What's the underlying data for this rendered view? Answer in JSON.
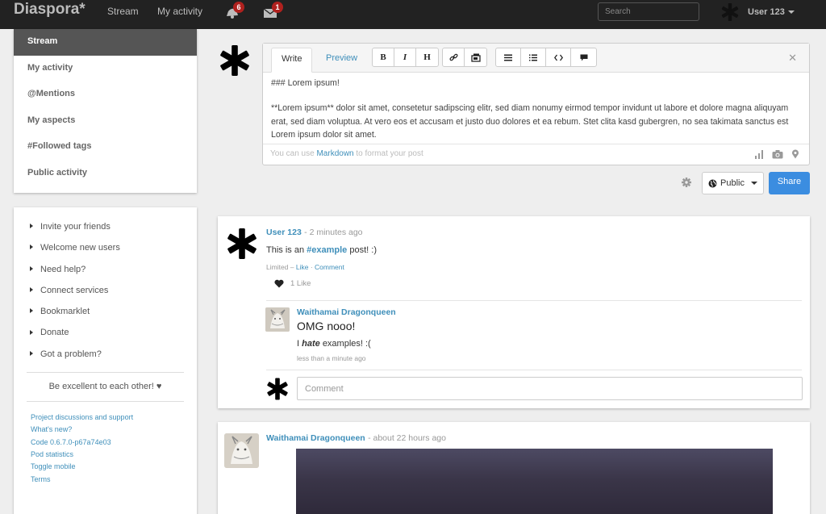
{
  "header": {
    "brand": "Diaspora*",
    "nav": [
      {
        "label": "Stream"
      },
      {
        "label": "My activity"
      }
    ],
    "notifications_count": "6",
    "messages_count": "1",
    "search_placeholder": "Search",
    "user_name": "User 123"
  },
  "sidebar": {
    "items": [
      {
        "label": "Stream"
      },
      {
        "label": "My activity"
      },
      {
        "label": "@Mentions"
      },
      {
        "label": "My aspects"
      },
      {
        "label": "#Followed tags"
      },
      {
        "label": "Public activity"
      }
    ],
    "links": [
      {
        "label": "Invite your friends"
      },
      {
        "label": "Welcome new users"
      },
      {
        "label": "Need help?"
      },
      {
        "label": "Connect services"
      },
      {
        "label": "Bookmarklet"
      },
      {
        "label": "Donate"
      },
      {
        "label": "Got a problem?"
      }
    ],
    "motto": "Be excellent to each other! ♥",
    "footer_links": [
      {
        "label": "Project discussions and support"
      },
      {
        "label": "What's new?"
      },
      {
        "label": "Code 0.6.7.0-p67a74e03"
      },
      {
        "label": "Pod statistics"
      },
      {
        "label": "Toggle mobile"
      },
      {
        "label": "Terms"
      }
    ]
  },
  "publisher": {
    "tab_write": "Write",
    "tab_preview": "Preview",
    "format_buttons": {
      "bold": "B",
      "italic": "I",
      "heading": "H"
    },
    "text_line1": "### Lorem ipsum!",
    "text_line2": "**Lorem ipsum** dolor sit amet, consetetur sadipscing elitr, sed diam nonumy eirmod tempor invidunt ut labore et dolore magna aliquyam erat, sed diam voluptua. At vero eos et accusam et justo duo dolores et ea rebum. Stet clita kasd gubergren, no sea takimata sanctus est Lorem ipsum dolor sit amet.",
    "hint_prefix": "You can use",
    "hint_link": "Markdown",
    "hint_suffix": "to format your post",
    "aspect_label": "Public",
    "share_label": "Share"
  },
  "posts": [
    {
      "author": "User 123",
      "time": "2 minutes ago",
      "body_prefix": "This is an",
      "body_tag": "#example",
      "body_suffix": "post! :)",
      "meta_scope": "Limited",
      "meta_like": "Like",
      "meta_comment": "Comment",
      "likes_count": "1 Like",
      "comment": {
        "author": "Waithamai Dragonqueen",
        "title": "OMG nooo!",
        "text_prefix": "I",
        "text_emph": "hate",
        "text_suffix": "examples! :(",
        "time": "less than a minute ago"
      },
      "comment_placeholder": "Comment"
    },
    {
      "author": "Waithamai Dragonqueen",
      "time": "about 22 hours ago"
    }
  ],
  "colors": {
    "topbar": "#222222",
    "link": "#3f8fba",
    "share": "#3b8de0",
    "badge": "#b0211e",
    "active_menu": "#555555"
  }
}
